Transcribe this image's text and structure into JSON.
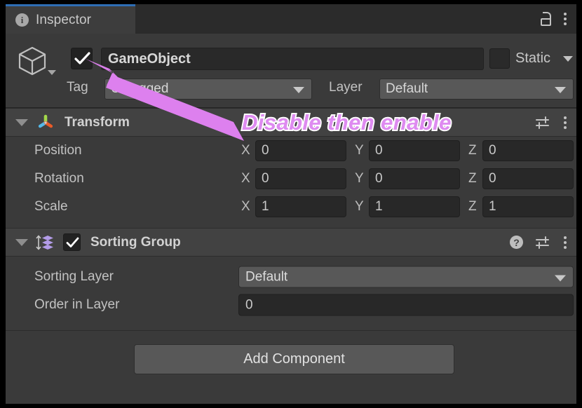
{
  "window": {
    "tab": {
      "label": "Inspector",
      "icon": "info-icon",
      "active": true,
      "accent_color": "#2E6EB5"
    },
    "toolbar": {
      "lock_icon": "lock-open-icon",
      "menu_icon": "kebab-menu-icon"
    }
  },
  "object_header": {
    "prefab_icon": "cube-icon",
    "active_checkbox": {
      "label": "",
      "checked": true
    },
    "name": "GameObject",
    "static": {
      "label": "Static",
      "checked": false
    },
    "tag": {
      "label": "Tag",
      "value": "Untagged"
    },
    "layer": {
      "label": "Layer",
      "value": "Default"
    }
  },
  "components": [
    {
      "title": "Transform",
      "icon": "transform-gizmo-icon",
      "expanded": true,
      "has_checkbox": false,
      "has_help": false,
      "header_icons": [
        "preset-settings-icon",
        "kebab-menu-icon"
      ],
      "rows": [
        {
          "label": "Position",
          "axes": [
            {
              "axis": "X",
              "value": "0"
            },
            {
              "axis": "Y",
              "value": "0"
            },
            {
              "axis": "Z",
              "value": "0"
            }
          ]
        },
        {
          "label": "Rotation",
          "axes": [
            {
              "axis": "X",
              "value": "0"
            },
            {
              "axis": "Y",
              "value": "0"
            },
            {
              "axis": "Z",
              "value": "0"
            }
          ]
        },
        {
          "label": "Scale",
          "axes": [
            {
              "axis": "X",
              "value": "1"
            },
            {
              "axis": "Y",
              "value": "1"
            },
            {
              "axis": "Z",
              "value": "1"
            }
          ]
        }
      ]
    },
    {
      "title": "Sorting Group",
      "icon": "sorting-group-icon",
      "expanded": true,
      "has_checkbox": true,
      "checked": true,
      "has_help": true,
      "header_icons": [
        "help-icon",
        "preset-settings-icon",
        "kebab-menu-icon"
      ],
      "fields": [
        {
          "label": "Sorting Layer",
          "value": "Default",
          "type": "dropdown"
        },
        {
          "label": "Order in Layer",
          "value": "0",
          "type": "number"
        }
      ]
    }
  ],
  "add_component": {
    "label": "Add Component"
  },
  "annotation": {
    "text": "Disable then enable",
    "text_color": "#DE8BF0",
    "outline_color": "#FFFFFF",
    "arrow_color": "#DD80EE",
    "arrow_points_to": "active-checkbox"
  }
}
